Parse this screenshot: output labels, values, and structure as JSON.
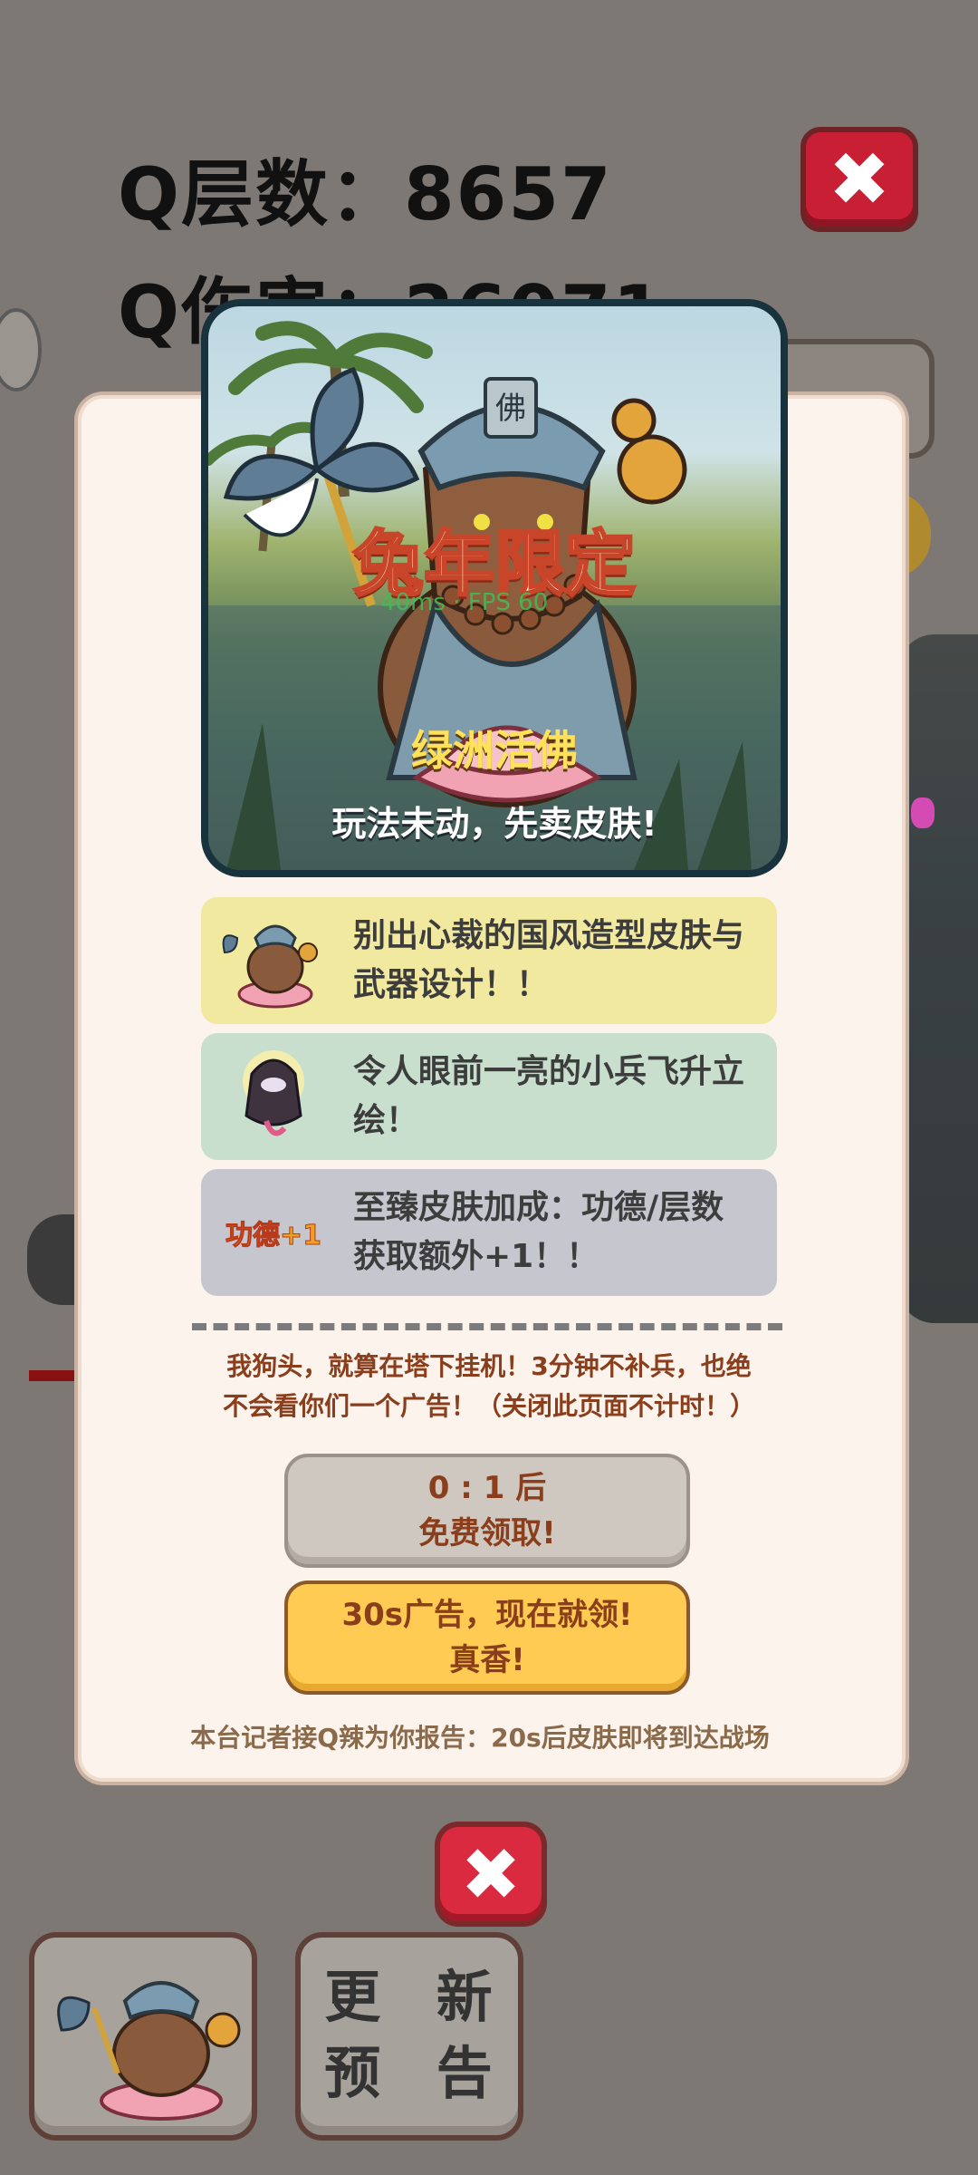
{
  "hud": {
    "q_layers_label": "Q层数：8657",
    "q_damage_label": "Q伤害：26071"
  },
  "banner": {
    "event_title": "兔年限定",
    "skin_name": "绿洲活佛",
    "caption": "玩法未动，先卖皮肤!",
    "debug_overlay": "40ms · FPS 60"
  },
  "features": [
    {
      "text": "别出心裁的国风造型皮肤与武器设计！！",
      "bg": "#f2e9a0"
    },
    {
      "text": "令人眼前一亮的小兵飞升立绘！",
      "bg": "#c8dfcd"
    },
    {
      "text": "至臻皮肤加成：功德/层数获取额外+1！！",
      "bg": "#c6c6cf",
      "icon_text": "功德+1"
    }
  ],
  "notice": {
    "line1": "我狗头，就算在塔下挂机！3分钟不补兵，也绝",
    "line2": "不会看你们一个广告！（关闭此页面不计时！）"
  },
  "buttons": {
    "free_timer": "0 : 1 后",
    "free_label": "免费领取!",
    "ad_line1": "30s广告，现在就领!",
    "ad_line2": "真香!"
  },
  "footer": "本台记者接Q辣为你报告：20s后皮肤即将到达战场",
  "bottom": {
    "preview_label": "更新预告",
    "preview_line1": "更 新",
    "preview_line2": "预 告"
  },
  "colors": {
    "accent_red": "#c91f35",
    "gold": "#ffcb52",
    "brown": "#8a3e1b"
  }
}
